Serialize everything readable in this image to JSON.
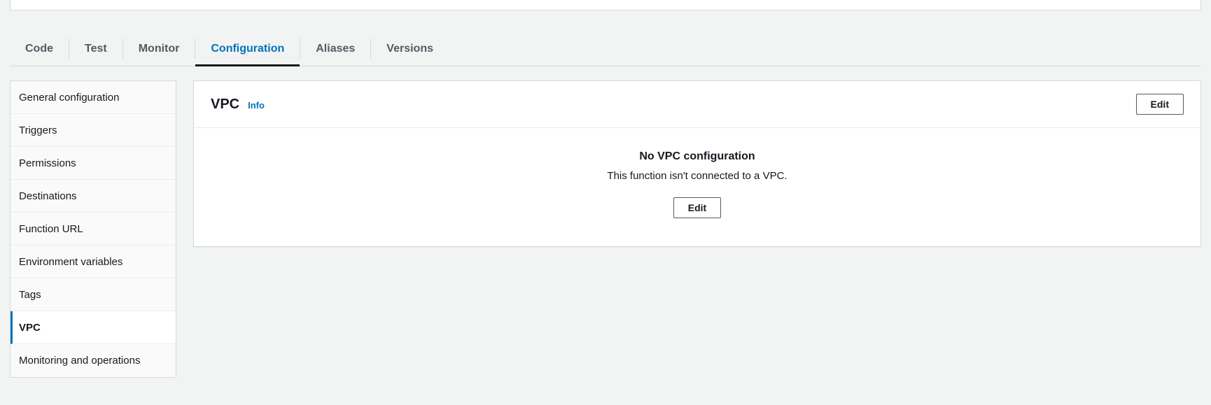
{
  "tabs": [
    {
      "label": "Code",
      "active": false
    },
    {
      "label": "Test",
      "active": false
    },
    {
      "label": "Monitor",
      "active": false
    },
    {
      "label": "Configuration",
      "active": true
    },
    {
      "label": "Aliases",
      "active": false
    },
    {
      "label": "Versions",
      "active": false
    }
  ],
  "sidebar": {
    "items": [
      {
        "label": "General configuration",
        "active": false
      },
      {
        "label": "Triggers",
        "active": false
      },
      {
        "label": "Permissions",
        "active": false
      },
      {
        "label": "Destinations",
        "active": false
      },
      {
        "label": "Function URL",
        "active": false
      },
      {
        "label": "Environment variables",
        "active": false
      },
      {
        "label": "Tags",
        "active": false
      },
      {
        "label": "VPC",
        "active": true
      },
      {
        "label": "Monitoring and operations",
        "active": false
      }
    ]
  },
  "panel": {
    "title": "VPC",
    "info_label": "Info",
    "edit_label": "Edit",
    "empty_title": "No VPC configuration",
    "empty_desc": "This function isn't connected to a VPC.",
    "empty_action_label": "Edit"
  }
}
